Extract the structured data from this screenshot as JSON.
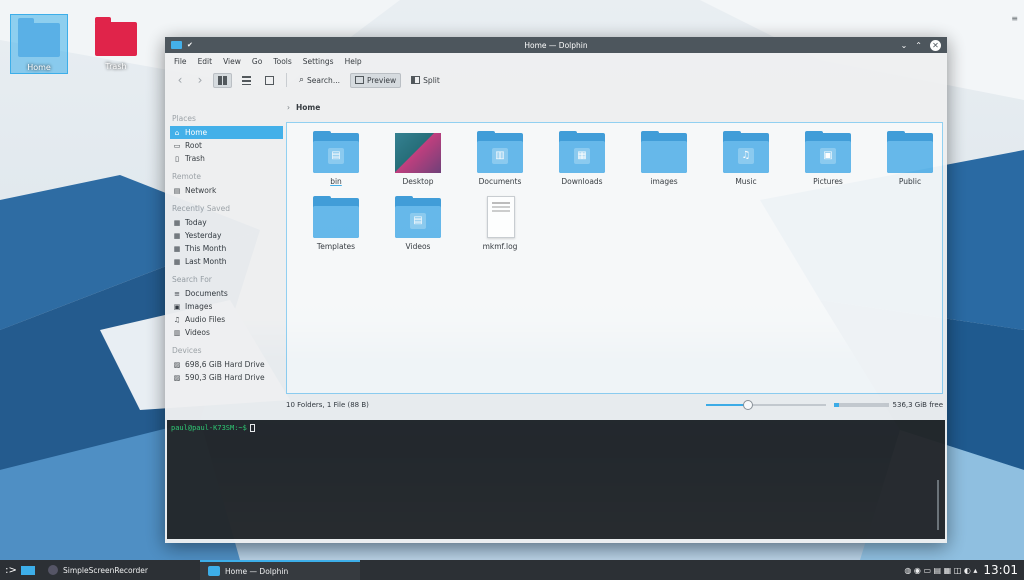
{
  "desktop": {
    "icons": [
      {
        "label": "Home"
      },
      {
        "label": "Trash"
      }
    ],
    "menu_glyph": "≡"
  },
  "window": {
    "title": "Home — Dolphin",
    "pin_glyph": "✔",
    "buttons": {
      "minimize": "⌄",
      "maximize": "⌃",
      "close": "✕"
    }
  },
  "menubar": [
    "File",
    "Edit",
    "View",
    "Go",
    "Tools",
    "Settings",
    "Help"
  ],
  "toolbar": {
    "back": "‹",
    "forward": "›",
    "search_label": "Search...",
    "preview_label": "Preview",
    "split_label": "Split"
  },
  "sidebar": {
    "sections": [
      {
        "title": "Places",
        "items": [
          {
            "label": "Home",
            "icon": "home-icon",
            "glyph": "⌂",
            "selected": true
          },
          {
            "label": "Root",
            "icon": "folder-red-icon",
            "glyph": "▭"
          },
          {
            "label": "Trash",
            "icon": "trash-icon",
            "glyph": "▯"
          }
        ]
      },
      {
        "title": "Remote",
        "items": [
          {
            "label": "Network",
            "icon": "network-icon",
            "glyph": "▤"
          }
        ]
      },
      {
        "title": "Recently Saved",
        "items": [
          {
            "label": "Today",
            "icon": "calendar-icon",
            "glyph": "▦"
          },
          {
            "label": "Yesterday",
            "icon": "calendar-icon",
            "glyph": "▦"
          },
          {
            "label": "This Month",
            "icon": "calendar-icon",
            "glyph": "▦"
          },
          {
            "label": "Last Month",
            "icon": "calendar-icon",
            "glyph": "▦"
          }
        ]
      },
      {
        "title": "Search For",
        "items": [
          {
            "label": "Documents",
            "icon": "documents-icon",
            "glyph": "≡"
          },
          {
            "label": "Images",
            "icon": "image-icon",
            "glyph": "▣"
          },
          {
            "label": "Audio Files",
            "icon": "music-icon",
            "glyph": "♫"
          },
          {
            "label": "Videos",
            "icon": "video-icon",
            "glyph": "▥"
          }
        ]
      },
      {
        "title": "Devices",
        "items": [
          {
            "label": "698,6 GiB Hard Drive",
            "icon": "harddrive-icon",
            "glyph": "▨"
          },
          {
            "label": "590,3 GiB Hard Drive",
            "icon": "harddrive-icon",
            "glyph": "▨"
          }
        ]
      }
    ]
  },
  "breadcrumb": {
    "chevron": "›",
    "current": "Home"
  },
  "files": [
    {
      "name": "bin",
      "kind": "folder",
      "emblem": "▤",
      "underlined": true
    },
    {
      "name": "Desktop",
      "kind": "desktop"
    },
    {
      "name": "Documents",
      "kind": "folder",
      "emblem": "▥"
    },
    {
      "name": "Downloads",
      "kind": "folder",
      "emblem": "▦"
    },
    {
      "name": "images",
      "kind": "folder",
      "emblem": ""
    },
    {
      "name": "Music",
      "kind": "folder",
      "emblem": "♫"
    },
    {
      "name": "Pictures",
      "kind": "folder",
      "emblem": "▣"
    },
    {
      "name": "Public",
      "kind": "folder",
      "emblem": ""
    },
    {
      "name": "Templates",
      "kind": "folder",
      "emblem": ""
    },
    {
      "name": "Videos",
      "kind": "folder",
      "emblem": "▤"
    },
    {
      "name": "mkmf.log",
      "kind": "log"
    }
  ],
  "status": {
    "summary": "10 Folders, 1 File (88 B)",
    "zoom_fraction": 0.35,
    "used_fraction": 0.1,
    "free_space": "536,3 GiB free"
  },
  "terminal": {
    "prompt": "paul@paul-K73SM:~$"
  },
  "taskbar": {
    "launcher_glyph": ":>",
    "tasks": [
      {
        "label": "SimpleScreenRecorder",
        "active": false
      },
      {
        "label": "Home — Dolphin",
        "active": true
      }
    ],
    "tray_glyphs": "◍ ◉ ▭ ▤ ▦ ◫ ◐ ▴",
    "clock": "13:01"
  },
  "colors": {
    "accent": "#3daee9",
    "folder": "#61b7ea",
    "titlebar": "#475057",
    "terminal": "#232629"
  }
}
